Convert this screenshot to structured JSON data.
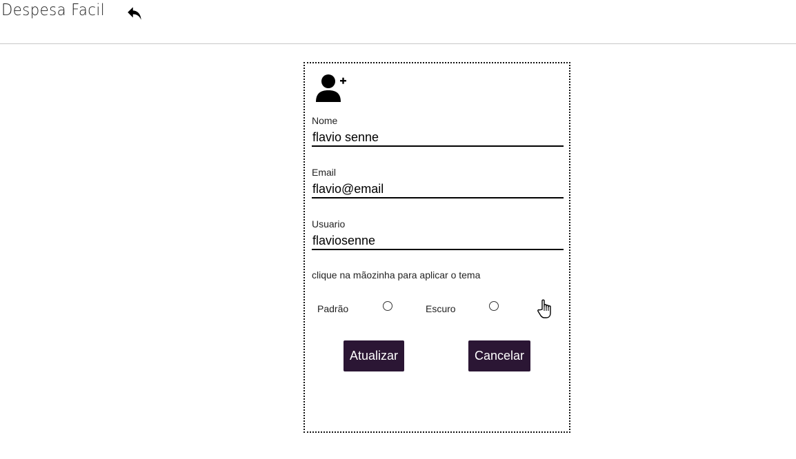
{
  "app": {
    "title": "Despesa Facil"
  },
  "icons": {
    "back": "reply-arrow-icon",
    "user": "user-plus-icon",
    "hand": "pointing-hand-icon"
  },
  "form": {
    "nome": {
      "label": "Nome",
      "value": "flavio senne"
    },
    "email": {
      "label": "Email",
      "value": "flavio@email"
    },
    "usuario": {
      "label": "Usuario",
      "value": "flaviosenne"
    },
    "hint": "clique na mãozinha para aplicar o tema",
    "themes": [
      {
        "label": "Padrão",
        "checked": false
      },
      {
        "label": "Escuro",
        "checked": false
      }
    ],
    "update_label": "Atualizar",
    "cancel_label": "Cancelar"
  },
  "colors": {
    "button_bg": "#2b1634",
    "button_text": "#ffffff",
    "divider": "#c8c8c8"
  }
}
